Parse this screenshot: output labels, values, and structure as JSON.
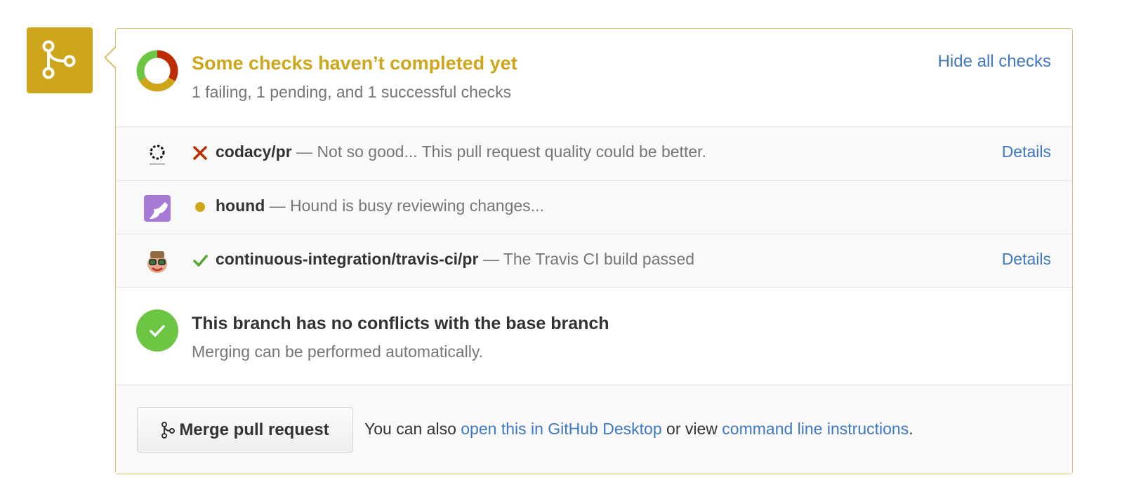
{
  "status": {
    "title": "Some checks haven’t completed yet",
    "subtitle": "1 failing, 1 pending, and 1 successful checks",
    "hide_label": "Hide all checks",
    "colors": {
      "failing": "#bd2c00",
      "pending": "#cea61b",
      "success": "#6cc644"
    },
    "counts": {
      "failing": 1,
      "pending": 1,
      "success": 1
    }
  },
  "checks": [
    {
      "status": "failing",
      "avatar_icon": "codacy-logo-icon",
      "name": "codacy/pr",
      "separator": "—",
      "description": "Not so good... This pull request quality could be better.",
      "details_label": "Details"
    },
    {
      "status": "pending",
      "avatar_icon": "hound-logo-icon",
      "name": "hound",
      "separator": "—",
      "description": "Hound is busy reviewing changes...",
      "details_label": ""
    },
    {
      "status": "success",
      "avatar_icon": "travis-ci-logo-icon",
      "name": "continuous-integration/travis-ci/pr",
      "separator": "—",
      "description": "The Travis CI build passed",
      "details_label": "Details"
    }
  ],
  "conflicts": {
    "title": "This branch has no conflicts with the base branch",
    "subtitle": "Merging can be performed automatically."
  },
  "merge": {
    "button_label": "Merge pull request",
    "note_prefix": "You can also",
    "desktop_link": "open this in GitHub Desktop",
    "note_middle": "or view",
    "cli_link": "command line instructions",
    "note_suffix": "."
  },
  "accent_color": "#cea61b",
  "link_color": "#4078c0"
}
